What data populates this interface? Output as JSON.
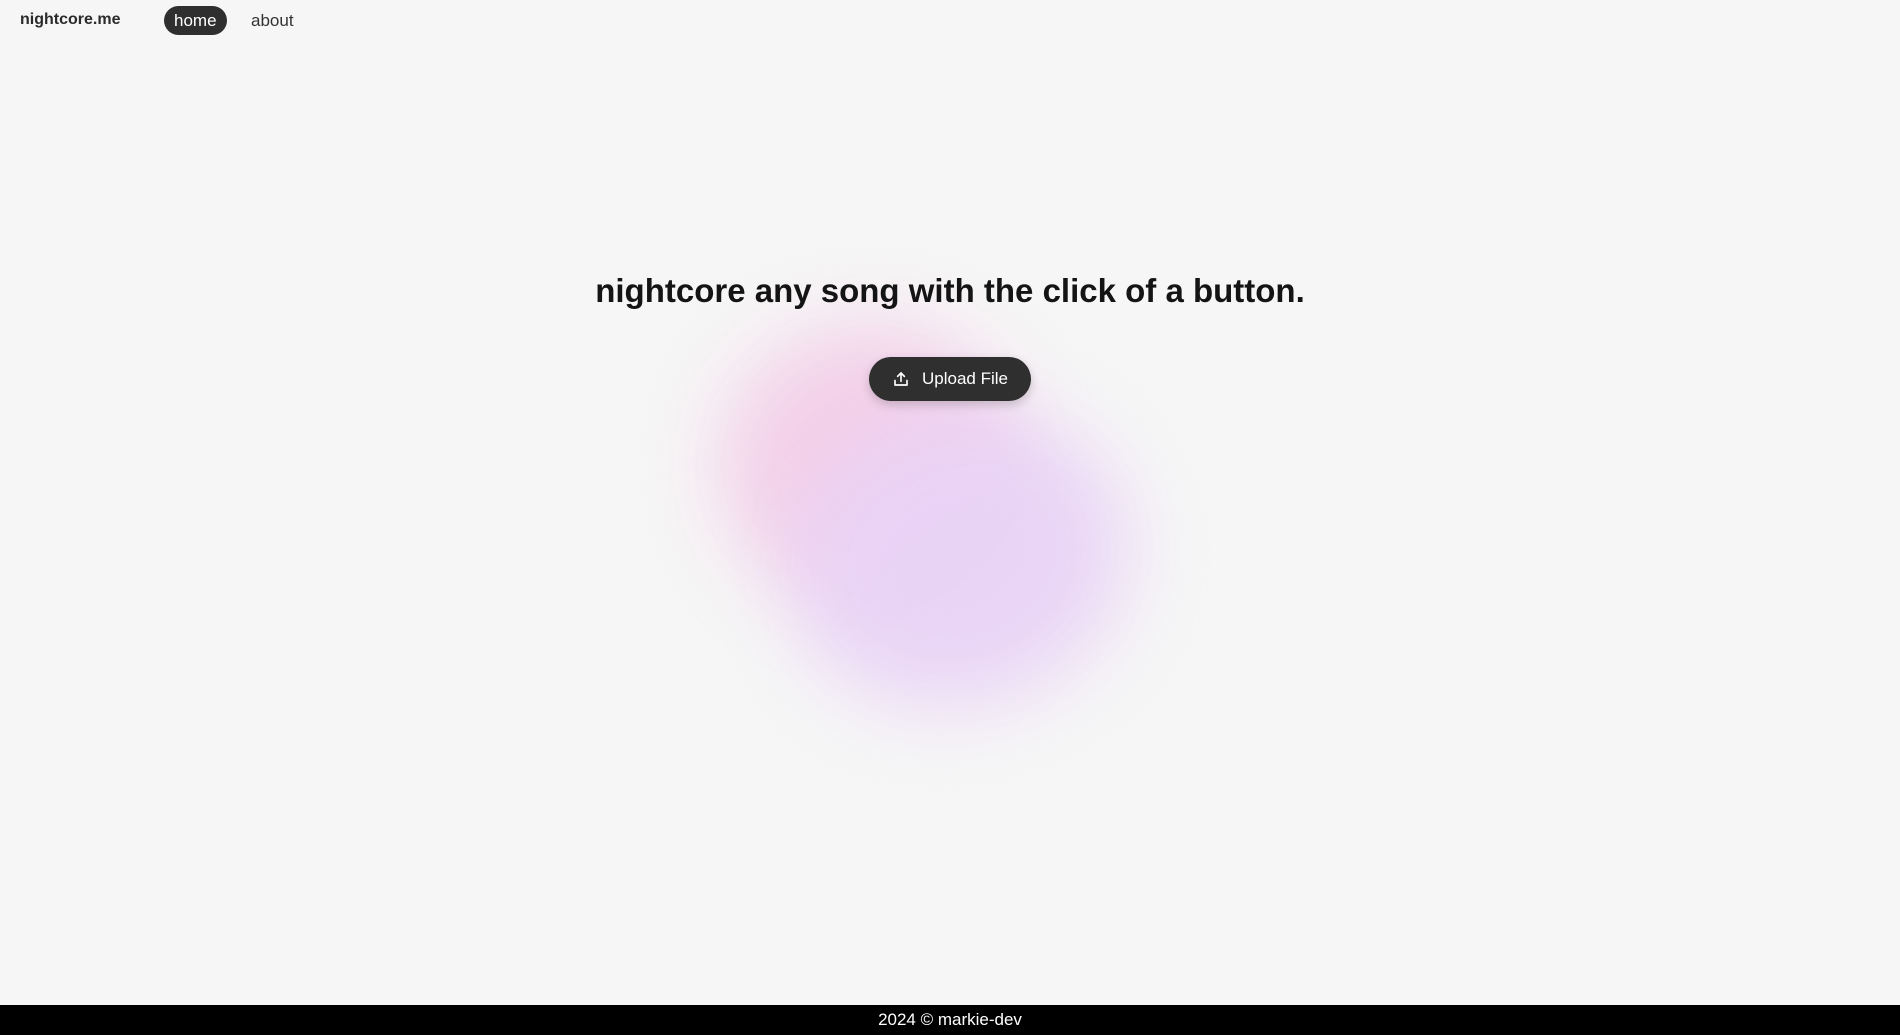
{
  "header": {
    "brand": "nightcore.me",
    "nav": [
      {
        "label": "home",
        "active": true
      },
      {
        "label": "about",
        "active": false
      }
    ]
  },
  "hero": {
    "title": "nightcore any song with the click of a button.",
    "upload_button": {
      "label": "Upload File",
      "icon": "upload-icon"
    }
  },
  "footer": {
    "text": "2024 © markie-dev"
  },
  "colors": {
    "background": "#f6f6f6",
    "button_dark": "#2f2f2f",
    "footer_bg": "#000000",
    "blob_pink": "#f3cde8",
    "blob_purple": "#e9d3f6"
  }
}
